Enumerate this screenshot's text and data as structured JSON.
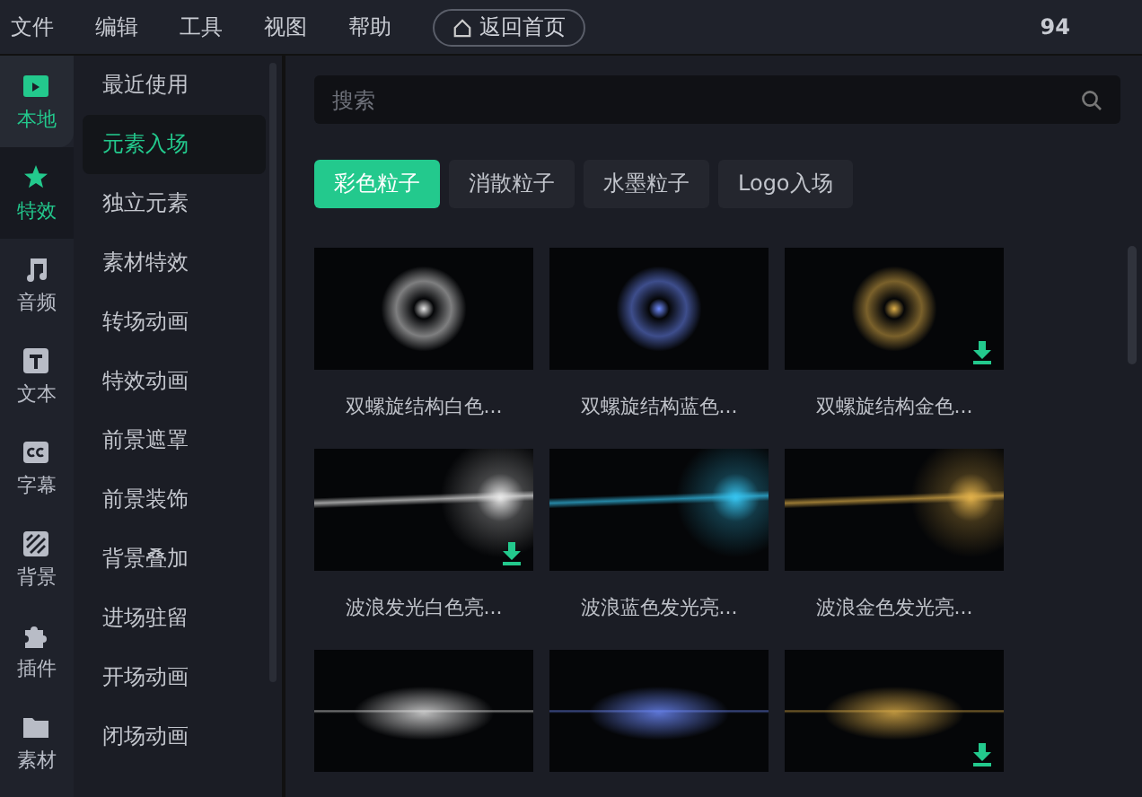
{
  "menu": [
    "文件",
    "编辑",
    "工具",
    "视图",
    "帮助"
  ],
  "home_button": "返回首页",
  "counter": "94",
  "rail": [
    {
      "kind": "local",
      "label": "本地",
      "selected": false,
      "hovered": true
    },
    {
      "kind": "effects",
      "label": "特效",
      "selected": true,
      "hovered": false
    },
    {
      "kind": "audio",
      "label": "音频",
      "selected": false,
      "hovered": false
    },
    {
      "kind": "text",
      "label": "文本",
      "selected": false,
      "hovered": false
    },
    {
      "kind": "captions",
      "label": "字幕",
      "selected": false,
      "hovered": false
    },
    {
      "kind": "background",
      "label": "背景",
      "selected": false,
      "hovered": false
    },
    {
      "kind": "plugins",
      "label": "插件",
      "selected": false,
      "hovered": false
    },
    {
      "kind": "assets",
      "label": "素材",
      "selected": false,
      "hovered": false
    }
  ],
  "categories": [
    {
      "label": "最近使用",
      "selected": false
    },
    {
      "label": "元素入场",
      "selected": true
    },
    {
      "label": "独立元素",
      "selected": false
    },
    {
      "label": "素材特效",
      "selected": false
    },
    {
      "label": "转场动画",
      "selected": false
    },
    {
      "label": "特效动画",
      "selected": false
    },
    {
      "label": "前景遮罩",
      "selected": false
    },
    {
      "label": "前景装饰",
      "selected": false
    },
    {
      "label": "背景叠加",
      "selected": false
    },
    {
      "label": "进场驻留",
      "selected": false
    },
    {
      "label": "开场动画",
      "selected": false
    },
    {
      "label": "闭场动画",
      "selected": false
    }
  ],
  "search": {
    "placeholder": "搜索"
  },
  "chips": [
    {
      "label": "彩色粒子",
      "selected": true
    },
    {
      "label": "消散粒子",
      "selected": false
    },
    {
      "label": "水墨粒子",
      "selected": false
    },
    {
      "label": "Logo入场",
      "selected": false
    }
  ],
  "items": [
    {
      "kind": "ring",
      "caption": "双螺旋结构白色...",
      "download": false
    },
    {
      "kind": "ring",
      "caption": "双螺旋结构蓝色...",
      "download": false
    },
    {
      "kind": "ring",
      "caption": "双螺旋结构金色...",
      "download": true
    },
    {
      "kind": "wave",
      "caption": "波浪发光白色亮...",
      "download": true
    },
    {
      "kind": "wave",
      "caption": "波浪蓝色发光亮...",
      "download": false
    },
    {
      "kind": "wave",
      "caption": "波浪金色发光亮...",
      "download": false
    },
    {
      "kind": "burst",
      "download": false
    },
    {
      "kind": "burst",
      "download": false
    },
    {
      "kind": "burst",
      "download": true
    }
  ]
}
